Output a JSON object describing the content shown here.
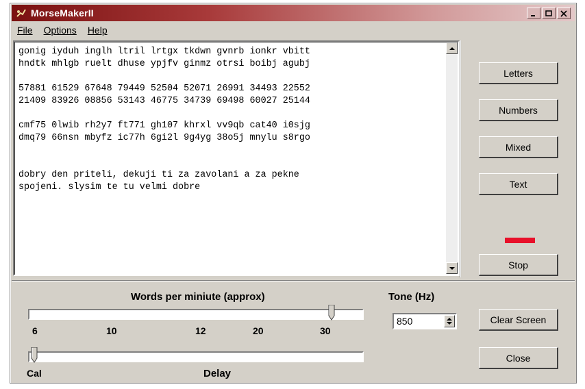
{
  "window": {
    "title": "MorseMakerII",
    "accent": "#7a1010"
  },
  "menu": [
    {
      "label": "File"
    },
    {
      "label": "Options"
    },
    {
      "label": "Help"
    }
  ],
  "text_area": {
    "content": "gonig iyduh inglh ltril lrtgx tkdwn gvnrb ionkr vbitt\nhndtk mhlgb ruelt dhuse ypjfv ginmz otrsi boibj agubj\n\n57881 61529 67648 79449 52504 52071 26991 34493 22552\n21409 83926 08856 53143 46775 34739 69498 60027 25144\n\ncmf75 0lwib rh2y7 ft771 gh107 khrxl vv9qb cat40 i0sjg\ndmq79 66nsn mbyfz ic77h 6gi2l 9g4yg 38o5j mnylu s8rgo\n\n\ndobry den priteli, dekuji ti za zavolani a za pekne\nspojeni. slysim te tu velmi dobre"
  },
  "buttons": {
    "letters": "Letters",
    "numbers": "Numbers",
    "mixed": "Mixed",
    "text": "Text",
    "stop": "Stop",
    "clear_screen": "Clear Screen",
    "close": "Close"
  },
  "indicator_color": "#e8102a",
  "wpm": {
    "label": "Words per miniute (approx)",
    "ticks": [
      "6",
      "10",
      "12",
      "20",
      "30"
    ],
    "value": "30"
  },
  "delay": {
    "label": "Delay",
    "min_label": "Cal"
  },
  "tone": {
    "label": "Tone (Hz)",
    "value": "850"
  }
}
